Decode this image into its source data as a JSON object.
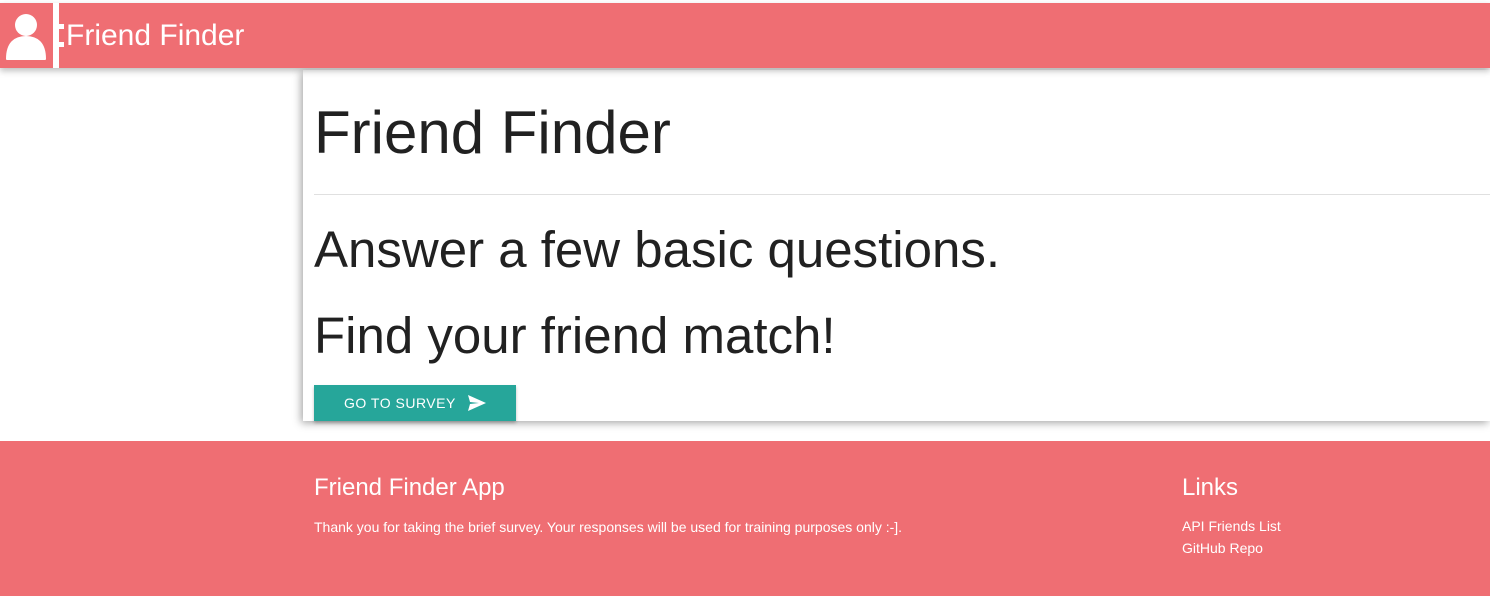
{
  "navbar": {
    "brand": "Friend Finder",
    "icon": "person-icon"
  },
  "hero": {
    "title": "Friend Finder",
    "line1": "Answer a few basic questions.",
    "line2": "Find your friend match!",
    "button_label": "GO TO SURVEY",
    "button_icon": "send-icon"
  },
  "footer": {
    "app_title": "Friend Finder App",
    "app_text": "Thank you for taking the brief survey. Your responses will be used for training purposes only :-].",
    "links_title": "Links",
    "links": [
      {
        "label": "API Friends List"
      },
      {
        "label": "GitHub Repo"
      }
    ]
  },
  "colors": {
    "brand": "#ef6e73",
    "button": "#26a69a",
    "text": "#212121"
  }
}
